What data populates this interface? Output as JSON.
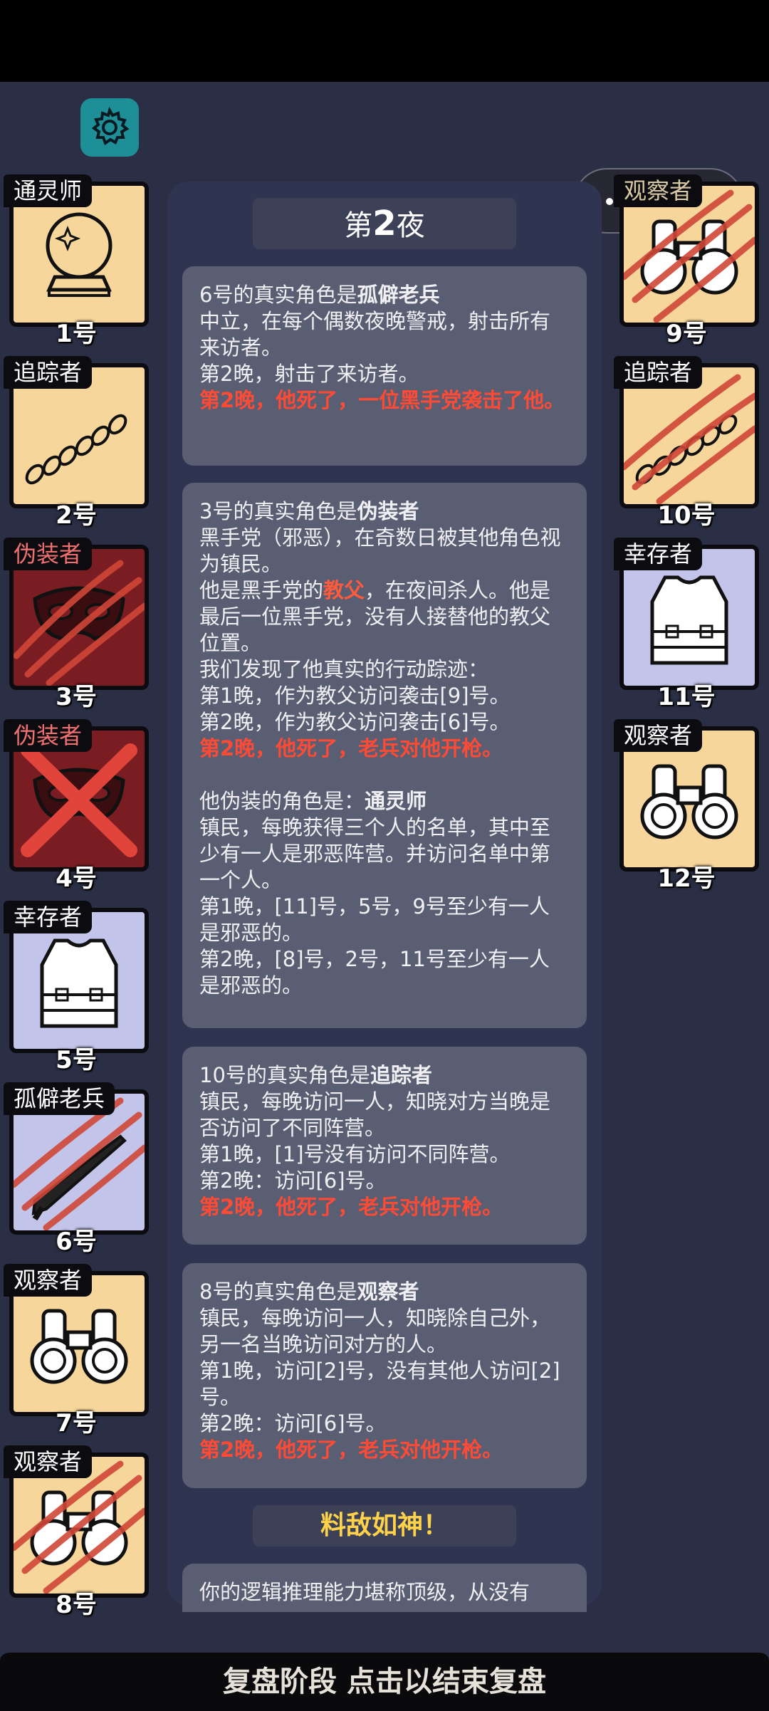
{
  "night": {
    "prefix": "第",
    "number": "2",
    "suffix": "夜"
  },
  "left_cards": [
    {
      "role": "通灵师",
      "num": "1号"
    },
    {
      "role": "追踪者",
      "num": "2号"
    },
    {
      "role": "伪装者",
      "num": "3号"
    },
    {
      "role": "伪装者",
      "num": "4号"
    },
    {
      "role": "幸存者",
      "num": "5号"
    },
    {
      "role": "孤僻老兵",
      "num": "6号"
    },
    {
      "role": "观察者",
      "num": "7号"
    },
    {
      "role": "观察者",
      "num": "8号"
    }
  ],
  "right_cards": [
    {
      "role": "观察者",
      "num": "9号"
    },
    {
      "role": "追踪者",
      "num": "10号"
    },
    {
      "role": "幸存者",
      "num": "11号"
    },
    {
      "role": "观察者",
      "num": "12号"
    }
  ],
  "entries": {
    "e1": {
      "l1a": "6号的真实角色是",
      "l1b": "孤僻老兵",
      "l2": "中立，在每个偶数夜晚警戒，射击所有来访者。",
      "l3": "第2晚，射击了来访者。",
      "l4": "第2晚，他死了，一位黑手党袭击了他。"
    },
    "e2": {
      "l1a": "3号的真实角色是",
      "l1b": "伪装者",
      "l2": "黑手党（邪恶），在奇数日被其他角色视为镇民。",
      "l3a": "他是黑手党的",
      "l3b": "教父",
      "l3c": "，在夜间杀人。他是最后一位黑手党，没有人接替他的教父位置。",
      "l4": "我们发现了他真实的行动踪迹：",
      "l5": "第1晚，作为教父访问袭击[9]号。",
      "l6": "第2晚，作为教父访问袭击[6]号。",
      "l7": "第2晚，他死了，老兵对他开枪。",
      "l8a": "他伪装的角色是：",
      "l8b": "通灵师",
      "l9": "镇民，每晚获得三个人的名单，其中至少有一人是邪恶阵营。并访问名单中第一个人。",
      "l10": "第1晚，[11]号，5号，9号至少有一人是邪恶的。",
      "l11": "第2晚，[8]号，2号，11号至少有一人是邪恶的。"
    },
    "e3": {
      "l1a": "10号的真实角色是",
      "l1b": "追踪者",
      "l2": "镇民，每晚访问一人，知晓对方当晚是否访问了不同阵营。",
      "l3": "第1晚，[1]号没有访问不同阵营。",
      "l4": "第2晚：访问[6]号。",
      "l5": "第2晚，他死了，老兵对他开枪。"
    },
    "e4": {
      "l1a": "8号的真实角色是",
      "l1b": "观察者",
      "l2": "镇民，每晚访问一人，知晓除自己外，另一名当晚访问对方的人。",
      "l3": "第1晚，访问[2]号，没有其他人访问[2]号。",
      "l4": "第2晚：访问[6]号。",
      "l5": "第2晚，他死了，老兵对他开枪。"
    }
  },
  "verdict": "料敌如神！",
  "final_text": "你的逻辑推理能力堪称顶级，从没有",
  "bottom_bar": "复盘阶段 点击以结束复盘"
}
